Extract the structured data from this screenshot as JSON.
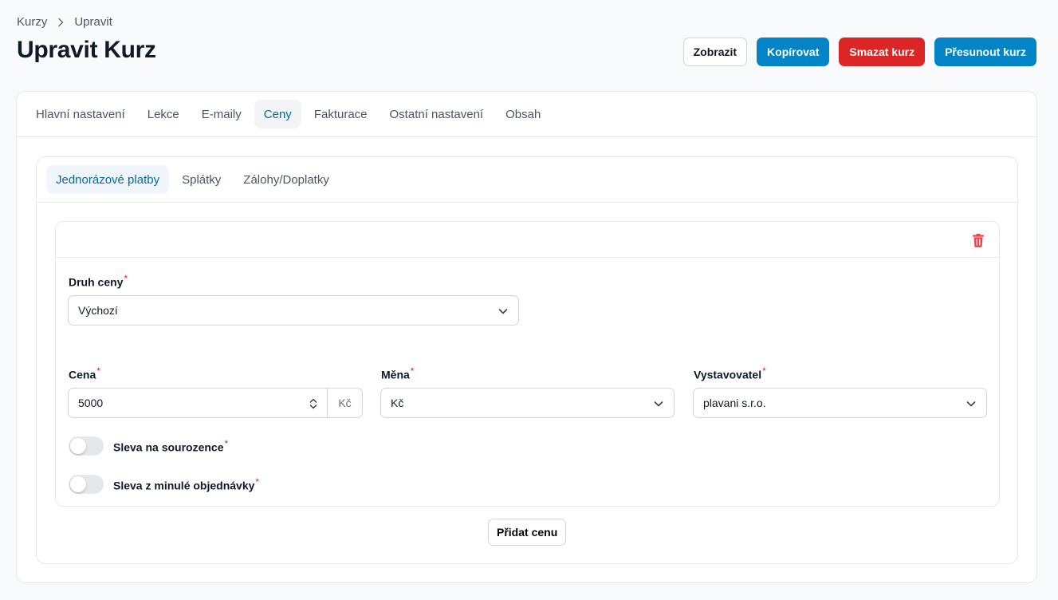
{
  "breadcrumb": {
    "root": "Kurzy",
    "current": "Upravit"
  },
  "page": {
    "title": "Upravit Kurz"
  },
  "actions": {
    "show": "Zobrazit",
    "copy": "Kopírovat",
    "delete": "Smazat kurz",
    "move": "Přesunout kurz"
  },
  "main_tabs": [
    {
      "label": "Hlavní nastavení"
    },
    {
      "label": "Lekce"
    },
    {
      "label": "E-maily"
    },
    {
      "label": "Ceny",
      "active": true
    },
    {
      "label": "Fakturace"
    },
    {
      "label": "Ostatní nastavení"
    },
    {
      "label": "Obsah"
    }
  ],
  "sub_tabs": [
    {
      "label": "Jednorázové platby",
      "active": true
    },
    {
      "label": "Splátky"
    },
    {
      "label": "Zálohy/Doplatky"
    }
  ],
  "form": {
    "price_type": {
      "label": "Druh ceny",
      "value": "Výchozí"
    },
    "price": {
      "label": "Cena",
      "value": "5000",
      "suffix": "Kč"
    },
    "currency": {
      "label": "Měna",
      "value": "Kč"
    },
    "issuer": {
      "label": "Vystavovatel",
      "value": "plavani s.r.o."
    },
    "sibling_discount": {
      "label": "Sleva na sourozence",
      "on": false
    },
    "previous_order_discount": {
      "label": "Sleva z minulé objednávky",
      "on": false
    },
    "required_mark": "*"
  },
  "add_price": "Přidat cenu",
  "colors": {
    "accent": "#0284c7",
    "danger": "#dc2626",
    "active_tab_text": "#0369a1"
  },
  "icons": {
    "breadcrumb_sep": "chevron-right-icon",
    "delete": "trash-icon",
    "select": "chevron-down-icon",
    "stepper": "stepper-icon"
  }
}
